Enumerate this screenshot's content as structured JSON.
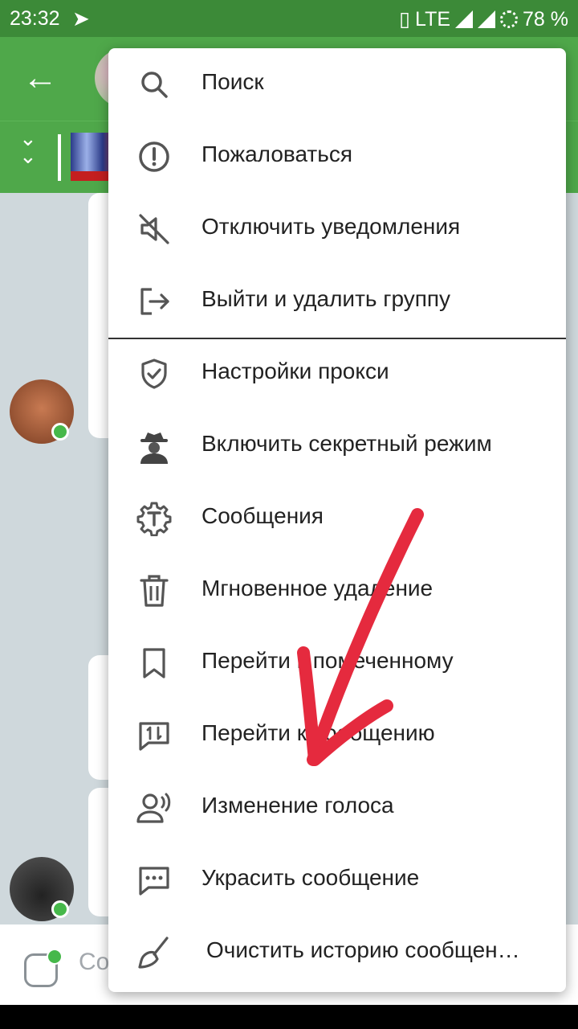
{
  "status_bar": {
    "time": "23:32",
    "network": "LTE",
    "battery": "78 %"
  },
  "input": {
    "placeholder_visible": "Со"
  },
  "menu": {
    "items": [
      {
        "label": "Поиск",
        "icon": "search-icon"
      },
      {
        "label": "Пожаловаться",
        "icon": "report-icon"
      },
      {
        "label": "Отключить уведомления",
        "icon": "mute-icon"
      },
      {
        "label": "Выйти и удалить группу",
        "icon": "leave-icon"
      },
      {
        "label": "Настройки прокси",
        "icon": "shield-icon"
      },
      {
        "label": "Включить секретный режим",
        "icon": "spy-icon"
      },
      {
        "label": "Сообщения",
        "icon": "gear-t-icon"
      },
      {
        "label": "Мгновенное удаление",
        "icon": "trash-icon"
      },
      {
        "label": "Перейти к помеченному",
        "icon": "bookmark-icon"
      },
      {
        "label": "Перейти к сообщению",
        "icon": "goto-message-icon"
      },
      {
        "label": "Изменение голоса",
        "icon": "voice-change-icon"
      },
      {
        "label": "Украсить сообщение",
        "icon": "decorate-message-icon"
      },
      {
        "label": "Очистить историю сообщен…",
        "icon": "broom-icon"
      }
    ]
  },
  "colors": {
    "toolbar": "#4fa84a",
    "statusbar": "#3c8a38",
    "online": "#46b84a",
    "annotation_arrow": "#e52a3e"
  }
}
